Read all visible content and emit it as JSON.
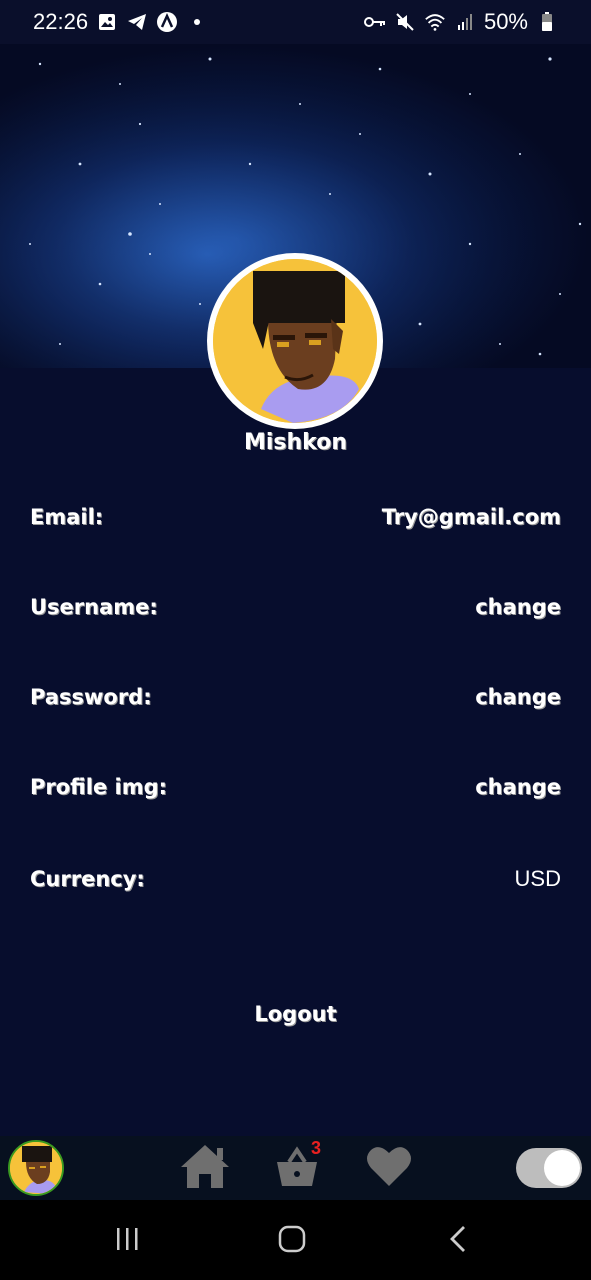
{
  "status_bar": {
    "time": "22:26",
    "battery": "50%",
    "left_icons": [
      "image-icon",
      "telegram-icon",
      "a-circle-icon",
      "dot-icon"
    ],
    "right_icons": [
      "key-icon",
      "mute-icon",
      "wifi-icon",
      "signal-icon",
      "battery-icon"
    ]
  },
  "profile": {
    "name": "Mishkon"
  },
  "rows": [
    {
      "label": "Email:",
      "value": "Try@gmail.com"
    },
    {
      "label": "Username:",
      "value": "change"
    },
    {
      "label": "Password:",
      "value": "change"
    },
    {
      "label": "Profile img:",
      "value": "change"
    },
    {
      "label": "Currency:",
      "value": "USD"
    }
  ],
  "logout_label": "Logout",
  "bottom_nav": {
    "cart_count": "3",
    "icons": [
      "avatar",
      "home-icon",
      "basket-icon",
      "heart-icon",
      "toggle"
    ]
  },
  "colors": {
    "background": "#070d2d",
    "avatar_bg": "#f6c23a",
    "badge": "#e82020"
  }
}
